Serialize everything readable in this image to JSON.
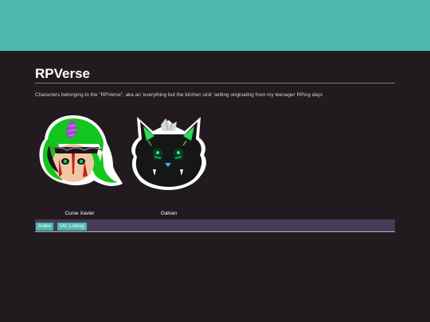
{
  "page": {
    "title": "RPVerse",
    "description": "Characters belonging to the \"RPVerse\", aka an 'everything but the kitchen sink' setting originating from my teenager RPing days"
  },
  "characters": [
    {
      "name": "Curse Xavier",
      "icon": "curse-xavier-portrait"
    },
    {
      "name": "Galvan",
      "icon": "galvan-portrait"
    }
  ],
  "nav": {
    "items": [
      {
        "label": "Index"
      },
      {
        "label": "OC Listing"
      }
    ]
  },
  "colors": {
    "header": "#4cb8b0",
    "background": "#211b20",
    "navbar": "#4a3b58",
    "button": "#4cb8b0"
  }
}
